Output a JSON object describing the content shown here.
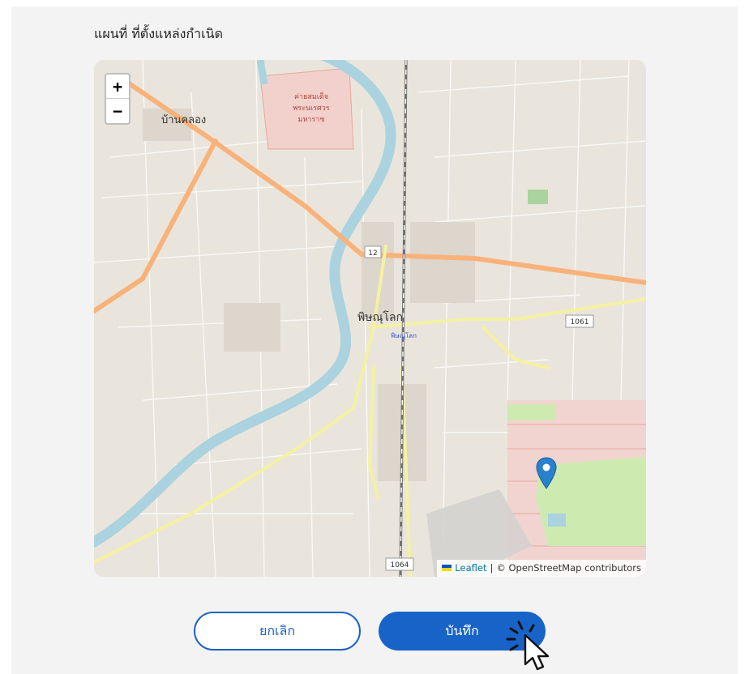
{
  "dialog": {
    "title": "แผนที่ ที่ตั้งแหล่งกำเนิด"
  },
  "map": {
    "zoom_in_label": "+",
    "zoom_out_label": "−",
    "labels": {
      "city": "พิษณุโลก",
      "station": "พิษณุโลก",
      "district": "บ้านคลอง",
      "camp_line1": "ค่ายสมเด็จ",
      "camp_line2": "พระนเรศวร",
      "camp_line3": "มหาราช",
      "route_12": "12",
      "route_1061": "1061",
      "route_1064": "1064"
    },
    "attribution": {
      "leaflet": "Leaflet",
      "separator": "|",
      "osm": "© OpenStreetMap contributors"
    },
    "colors": {
      "background": "#e9e5dc",
      "river": "#aad3df",
      "major_road": "#f9b27a",
      "secondary_road": "#f4f1a2",
      "park": "#cdebb0",
      "residential_red": "#f2d1cc",
      "marker": "#2a81cb"
    }
  },
  "actions": {
    "cancel_label": "ยกเลิก",
    "save_label": "บันทึก"
  },
  "colors": {
    "primary": "#1763c7",
    "panel": "#f3f3f3"
  }
}
